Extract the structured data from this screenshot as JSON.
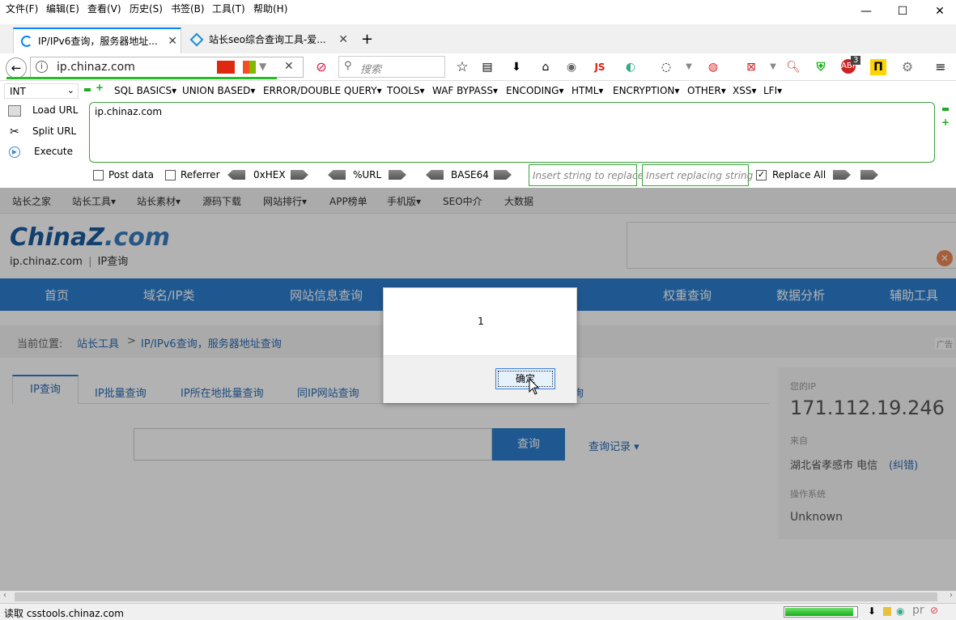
{
  "menu": {
    "items": [
      "文件(F)",
      "编辑(E)",
      "查看(V)",
      "历史(S)",
      "书签(B)",
      "工具(T)",
      "帮助(H)"
    ]
  },
  "window_controls": {
    "minimize": "—",
    "maximize": "☐",
    "close": "✕"
  },
  "tabs": [
    {
      "title": "IP/IPv6查询，服务器地址...",
      "active": true
    },
    {
      "title": "站长seo综合查询工具-爱...",
      "active": false
    }
  ],
  "new_tab_label": "+",
  "address": {
    "url": "ip.chinaz.com"
  },
  "search": {
    "placeholder": "搜索"
  },
  "toolbar_js_label": "JS",
  "badge_count": "3",
  "hackbar": {
    "select_value": "INT",
    "menus": [
      "SQL BASICS▾",
      "UNION BASED▾",
      "ERROR/DOUBLE QUERY▾",
      "TOOLS▾",
      "WAF BYPASS▾",
      "ENCODING▾",
      "HTML▾",
      "ENCRYPTION▾",
      "OTHER▾",
      "XSS▾",
      "LFI▾"
    ],
    "load_url": "Load URL",
    "split_url": "Split URL",
    "execute": "Execute",
    "url_value": "ip.chinaz.com",
    "post_data": "Post data",
    "referrer": "Referrer",
    "hex": "0xHEX",
    "url_enc": "%URL",
    "base64": "BASE64",
    "insert_string_placeholder": "Insert string to replace",
    "insert_replacing_placeholder": "Insert replacing string",
    "replace_all": "Replace All"
  },
  "site": {
    "topnav": [
      "站长之家",
      "站长工具▾",
      "站长素材▾",
      "源码下载",
      "网站排行▾",
      "APP榜单",
      "手机版▾",
      "SEO中介",
      "大数据"
    ],
    "logo_main": "ChinaZ",
    "logo_tld": ".com",
    "sublogo_domain": "ip.chinaz.com",
    "sublogo_sep": "|",
    "sublogo_title": "IP查询",
    "bluenav": [
      "首页",
      "域名/IP类",
      "网站信息查询",
      "权重查询",
      "数据分析",
      "辅助工具"
    ],
    "crumb_label": "当前位置:",
    "crumb_link": "站长工具",
    "crumb_sep": ">",
    "crumb_current": "IP/IPv6查询，服务器地址查询",
    "ad_corner": "广告",
    "tabs": [
      "IP查询",
      "IP批量查询",
      "IP所在地批量查询",
      "同IP网站查询",
      "询"
    ],
    "query_button": "查询",
    "query_record": "查询记录 ▾",
    "your_ip_label": "您的IP",
    "your_ip": "171.112.19.246",
    "from_label": "来自",
    "from_value": "湖北省孝感市 电信",
    "correct_link": "(纠错)",
    "os_label": "操作系统",
    "os_value": "Unknown"
  },
  "dialog": {
    "message": "1",
    "ok": "确定"
  },
  "status": {
    "text": "读取 csstools.chinaz.com",
    "progress": 0.95
  },
  "colors": {
    "accent": "#0a84ff",
    "site_blue": "#2d7fcf",
    "hackbar_green": "#3da13d"
  }
}
